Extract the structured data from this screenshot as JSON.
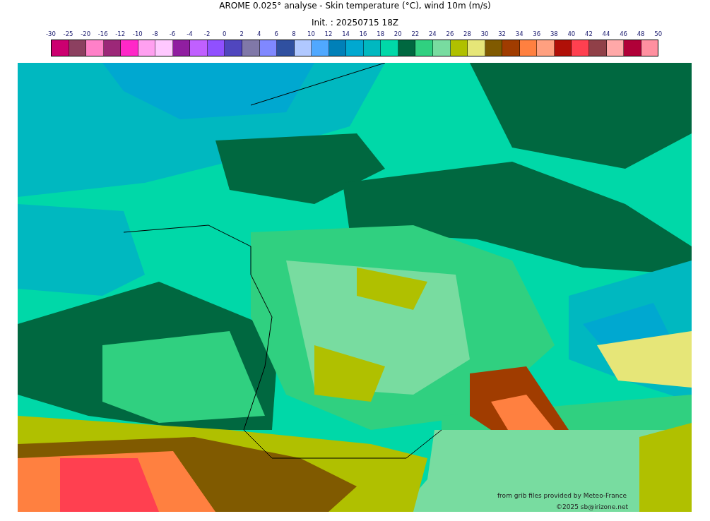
{
  "title": "AROME 0.025° analyse - Skin temperature (°C), wind 10m (m/s)",
  "subtitle": "Init. : 20250715 18Z",
  "colorbar": {
    "ticks": [
      "-30",
      "-25",
      "-20",
      "-16",
      "-12",
      "-10",
      "-8",
      "-6",
      "-4",
      "-2",
      "0",
      "2",
      "4",
      "6",
      "8",
      "10",
      "12",
      "14",
      "16",
      "18",
      "20",
      "22",
      "24",
      "26",
      "28",
      "30",
      "32",
      "34",
      "36",
      "38",
      "40",
      "42",
      "44",
      "46",
      "48",
      "50"
    ],
    "swatches": [
      {
        "color": "#cc0070"
      },
      {
        "color": "#8c4060"
      },
      {
        "color": "#ff80c8"
      },
      {
        "color": "#9c2878"
      },
      {
        "color": "#ff28c8"
      },
      {
        "color": "#ffa0f0"
      },
      {
        "color": "#ffc8ff"
      },
      {
        "color": "#901ea0"
      },
      {
        "color": "#c060ff"
      },
      {
        "color": "#9050ff"
      },
      {
        "color": "#5046be"
      },
      {
        "color": "#8078a8"
      },
      {
        "color": "#8088ff"
      },
      {
        "color": "#3050a0"
      },
      {
        "color": "#b0c8ff"
      },
      {
        "color": "#50a8ff"
      },
      {
        "color": "#0080b8"
      },
      {
        "color": "#00a8d0"
      },
      {
        "color": "#00b8c0"
      },
      {
        "color": "#00d8a8"
      },
      {
        "color": "#006840"
      },
      {
        "color": "#30d080"
      },
      {
        "color": "#78dca0"
      },
      {
        "color": "#b0c000"
      },
      {
        "color": "#e6e678"
      },
      {
        "color": "#805a00"
      },
      {
        "color": "#a03c00"
      },
      {
        "color": "#ff8040"
      },
      {
        "color": "#ffa080"
      },
      {
        "color": "#b01008"
      },
      {
        "color": "#ff4050"
      },
      {
        "color": "#904048"
      },
      {
        "color": "#ffa8a8"
      },
      {
        "color": "#b00038"
      },
      {
        "color": "#ff90a0"
      }
    ]
  },
  "map": {
    "credit": "from grib files provided by Meteo-France",
    "copyright": "©2025 sb@irizone.net"
  }
}
